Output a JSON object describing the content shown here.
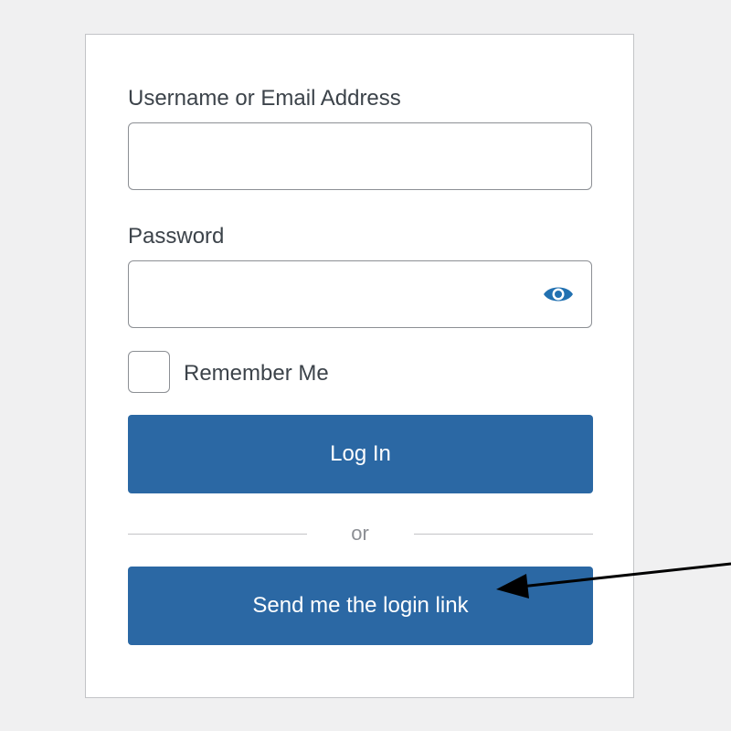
{
  "form": {
    "username_label": "Username or Email Address",
    "username_value": "",
    "password_label": "Password",
    "password_value": "",
    "show_password_icon": "eye-icon",
    "remember_label": "Remember Me",
    "remember_checked": false,
    "login_button_label": "Log In",
    "divider_text": "or",
    "magic_link_button_label": "Send me the login link"
  },
  "colors": {
    "page_background": "#f0f0f1",
    "card_background": "#ffffff",
    "primary_button": "#2b68a4",
    "accent_icon": "#2271b1",
    "annotation_arrow": "#000000"
  }
}
